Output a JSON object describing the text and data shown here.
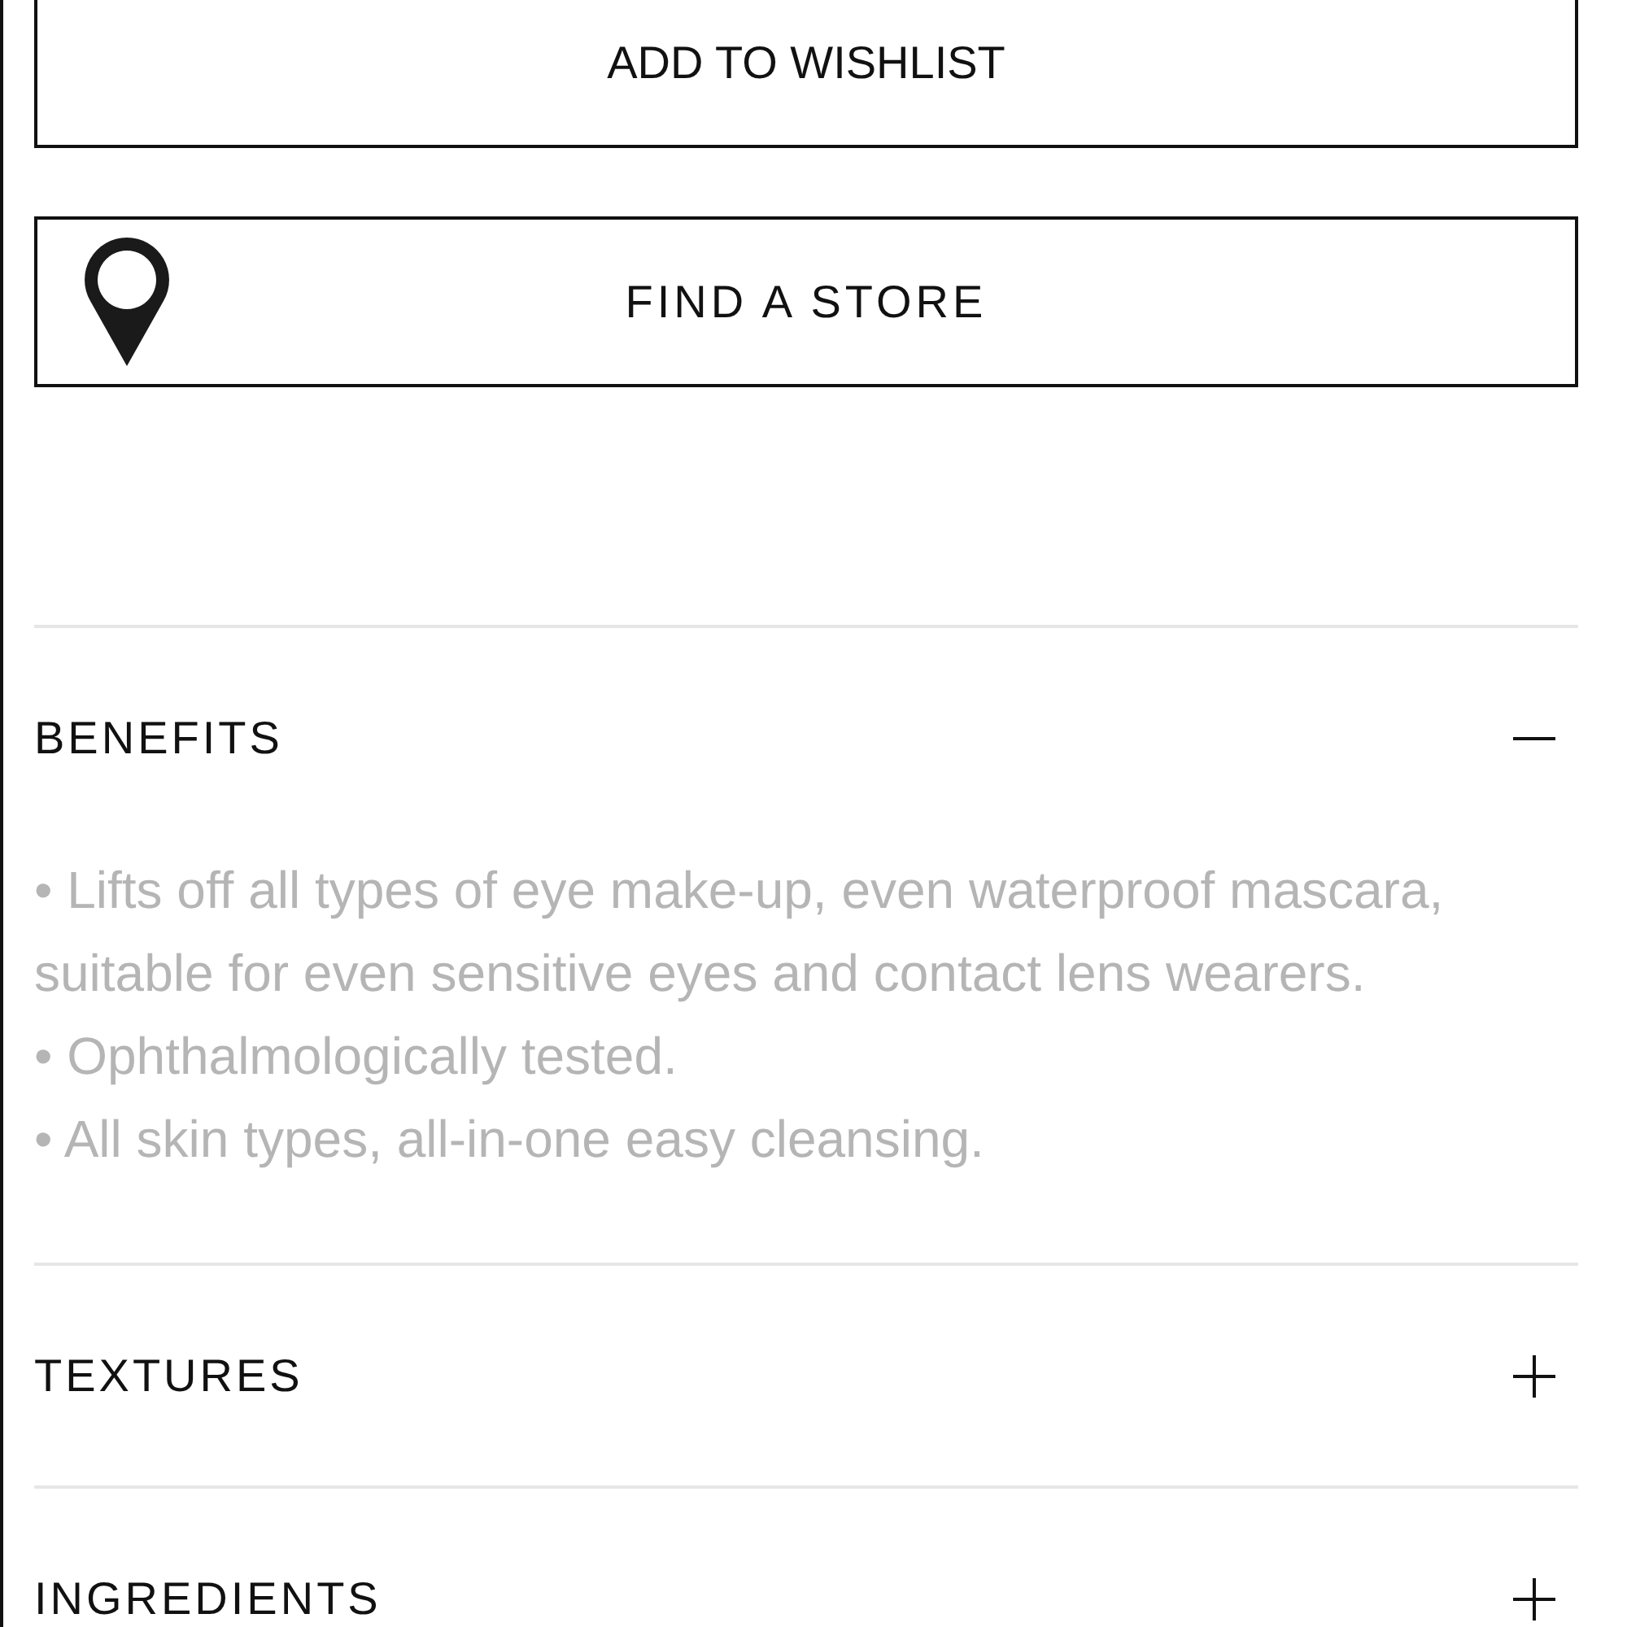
{
  "buttons": [
    {
      "kind": "wishlist",
      "label": "ADD TO WISHLIST"
    },
    {
      "kind": "store",
      "label": "FIND A STORE"
    }
  ],
  "sections": [
    {
      "title": "BENEFITS",
      "expanded": true,
      "items": [
        "• Lifts off all types of eye make-up, even waterproof mascara, suitable for even sensitive eyes and contact lens wearers.",
        "• Ophthalmologically tested.",
        "• All skin types, all-in-one easy cleansing."
      ]
    },
    {
      "title": "TEXTURES",
      "expanded": false
    },
    {
      "title": "INGREDIENTS",
      "expanded": false
    }
  ]
}
